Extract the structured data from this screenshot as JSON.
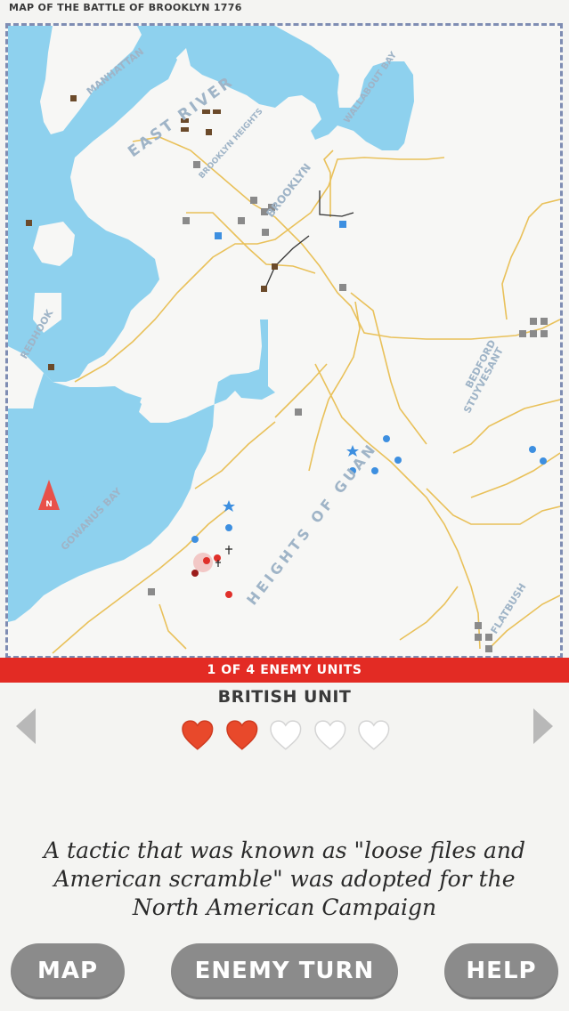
{
  "map_title": "MAP OF THE BATTLE OF BROOKLYN 1776",
  "map": {
    "labels": {
      "manhattan": "MANHATTAN",
      "east_river": "EAST RIVER",
      "brooklyn_heights": "BROOKLYN HEIGHTS",
      "wallabout_bay": "WALLABOUT BAY",
      "brooklyn": "BROOKLYN",
      "redhook": "REDHOOK",
      "bedford": "BEDFORD",
      "stuyvesant": "STUYVESANT",
      "heights_of_guan": "HEIGHTS OF GUAN",
      "gowanus_bay": "GOWANUS BAY",
      "flatbush": "FLATBUSH",
      "compass": "N"
    },
    "colors": {
      "water": "#8ed1ee",
      "land": "#f7f7f5",
      "roads": "#e9c15a",
      "american_units": "#3d8fe0",
      "british_units": "#e0302a",
      "selected_unit": "#9b1c1a"
    }
  },
  "banner": "1 OF 4 ENEMY UNITS",
  "unit": {
    "name": "BRITISH UNIT",
    "health": 2,
    "max_health": 5
  },
  "icons": {
    "prev": "chevron-left-icon",
    "next": "chevron-right-icon",
    "heart": "heart-icon"
  },
  "quote": "A tactic that was known as \"loose files and American scramble\" was adopted for the North American Campaign",
  "buttons": {
    "map": "MAP",
    "enemy_turn": "ENEMY TURN",
    "help": "HELP"
  }
}
